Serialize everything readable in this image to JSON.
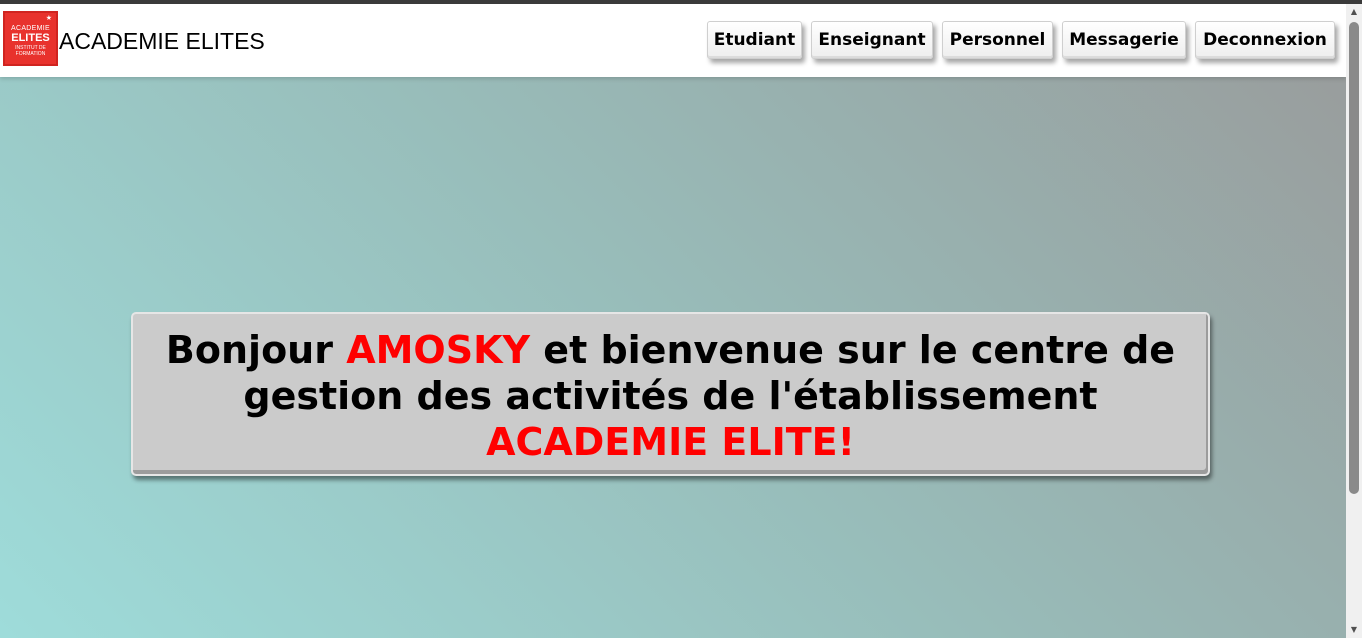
{
  "header": {
    "logo": {
      "line1": "ACADEMIE",
      "line2": "ELITES",
      "line3": "INSTITUT DE",
      "line4": "FORMATION",
      "star": "★"
    },
    "brand_name": "ACADEMIE ELITES",
    "nav": [
      {
        "label": "Etudiant"
      },
      {
        "label": "Enseignant"
      },
      {
        "label": "Personnel"
      },
      {
        "label": "Messagerie"
      },
      {
        "label": "Deconnexion"
      }
    ]
  },
  "welcome": {
    "greeting": "Bonjour ",
    "user": "AMOSKY",
    "message": " et bienvenue sur le centre de gestion des activités de l'établissement ",
    "school": "ACADEMIE ELITE!"
  },
  "scrollbar": {
    "up_icon": "▲",
    "down_icon": "▼"
  },
  "colors": {
    "accent": "#ff0000",
    "logo_red": "#e8322d",
    "panel": "#cbcbcb",
    "gradient_start": "#9edcda",
    "gradient_end": "#999b9b"
  }
}
